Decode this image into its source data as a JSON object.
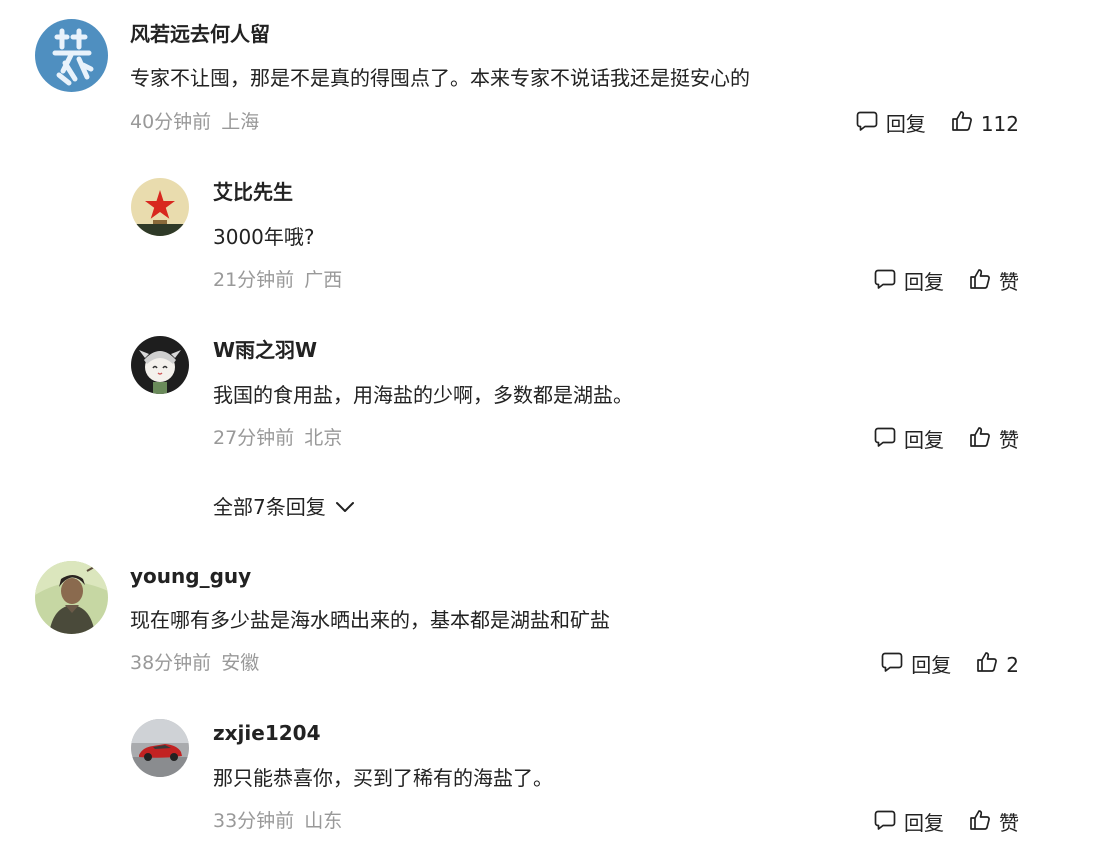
{
  "comments": [
    {
      "username": "风若远去何人留",
      "content": "专家不让囤，那是不是真的得囤点了。本来专家不说话我还是挺安心的",
      "time": "40分钟前",
      "location": "上海",
      "reply_label": "回复",
      "like_label": "112"
    },
    {
      "username": "艾比先生",
      "content": "3000年哦?",
      "time": "21分钟前",
      "location": "广西",
      "reply_label": "回复",
      "like_label": "赞"
    },
    {
      "username": "W雨之羽W",
      "content": "我国的食用盐，用海盐的少啊，多数都是湖盐。",
      "time": "27分钟前",
      "location": "北京",
      "reply_label": "回复",
      "like_label": "赞"
    },
    {
      "username": "young_guy",
      "content": "现在哪有多少盐是海水晒出来的，基本都是湖盐和矿盐",
      "time": "38分钟前",
      "location": "安徽",
      "reply_label": "回复",
      "like_label": "2"
    },
    {
      "username": "zxjie1204",
      "content": "那只能恭喜你，买到了稀有的海盐了。",
      "time": "33分钟前",
      "location": "山东",
      "reply_label": "回复",
      "like_label": "赞"
    }
  ],
  "more_replies": {
    "label": "全部7条回复",
    "icon": "chevron-down-icon"
  },
  "icons": {
    "reply": "comment-bubble-icon",
    "like": "thumbs-up-icon"
  },
  "colors": {
    "text": "#222222",
    "meta": "#999999",
    "background": "#ffffff"
  }
}
